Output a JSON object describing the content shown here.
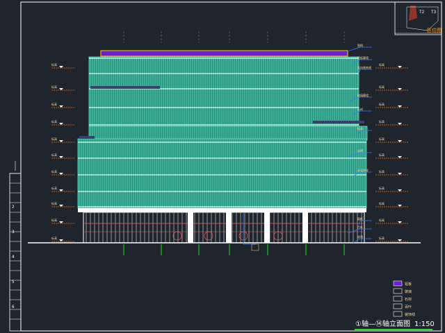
{
  "drawing": {
    "title": "①轴—⑭轴立面图",
    "scale": "1:150",
    "key_plan_label": "区位图",
    "key_plan_marks": [
      "T2",
      "T3"
    ]
  },
  "colors": {
    "background": "#1f252c",
    "frame": "#ffffff",
    "facade": "#62e6c9",
    "facade_dark": "#2a8f7a",
    "parapet": "#6a1fd0",
    "parapet_edge": "#ffd400",
    "leader": "#3a7cff",
    "level_mark": "#ff6a00",
    "ground_line": "#ffffff",
    "axis_line": "#1ee01e",
    "glazing_frame": "#ff5a5a"
  },
  "level_labels_left": [
    "标高",
    "标高",
    "标高",
    "标高",
    "标高",
    "标高",
    "标高",
    "标高",
    "标高",
    "标高",
    "标高"
  ],
  "level_labels_right": [
    "标高",
    "标高",
    "标高",
    "标高",
    "标高",
    "标高",
    "标高",
    "标高",
    "标高",
    "标高",
    "标高"
  ],
  "annotations": [
    "图例",
    "铝板幕墙",
    "竖向装饰线",
    "玻璃幕墙",
    "石材",
    "标高",
    "说明",
    "详见大样",
    "窗框",
    "百叶",
    "说明"
  ],
  "legend": {
    "entries": [
      {
        "swatch": "#6a1fd0",
        "label": "铝板"
      },
      {
        "swatch": "#ffffff",
        "label": "玻璃"
      },
      {
        "swatch": "#ffffff",
        "label": "石材"
      },
      {
        "swatch": "#ffffff",
        "label": "百叶"
      },
      {
        "swatch": "#ffffff",
        "label": "装饰线"
      }
    ]
  },
  "title_block_marks": [
    "2",
    "3",
    "4",
    "5",
    "6"
  ]
}
